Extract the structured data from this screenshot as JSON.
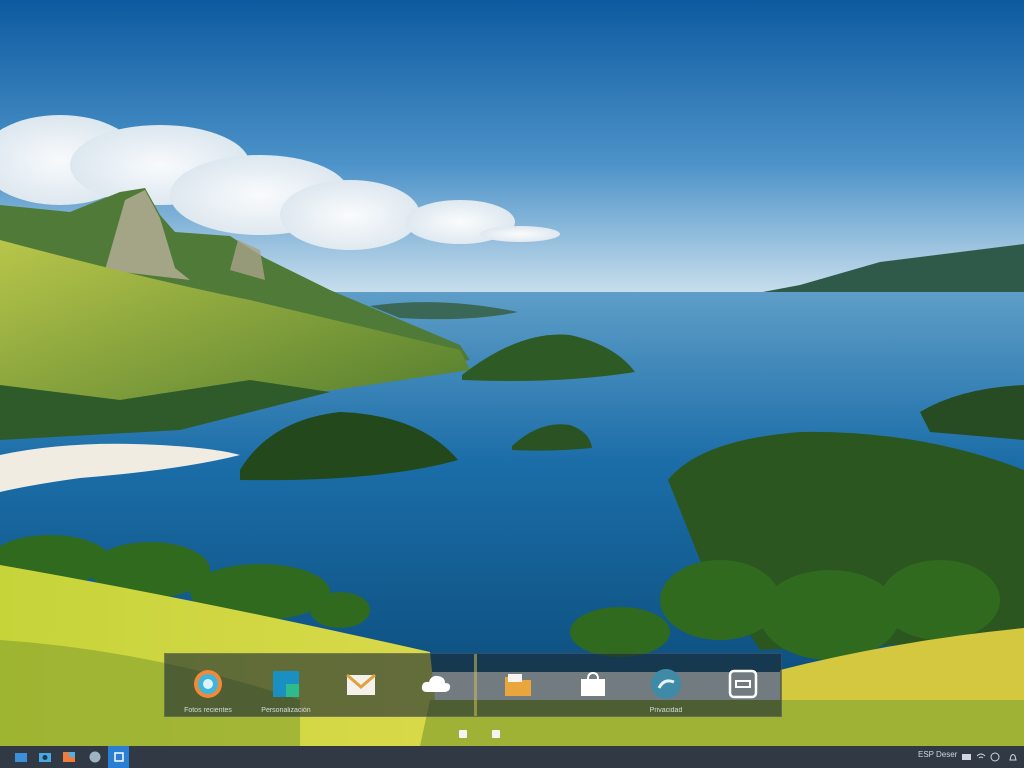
{
  "wallpaper": {
    "name": "coastal-lake-landscape"
  },
  "dock": {
    "items": [
      {
        "icon": "photos-icon",
        "label": "Fotos recientes"
      },
      {
        "icon": "store-app-icon",
        "label": "Personalización"
      },
      {
        "icon": "mail-icon",
        "label": ""
      },
      {
        "icon": "cloud-icon",
        "label": ""
      },
      {
        "icon": "folder-icon",
        "label": ""
      },
      {
        "icon": "store-bag-icon",
        "label": ""
      },
      {
        "icon": "edge-icon",
        "label": "Privacidad"
      },
      {
        "icon": "window-icon",
        "label": ""
      }
    ]
  },
  "taskbar": {
    "apps": [
      "file-explorer-icon",
      "camera-icon",
      "photos-icon",
      "globe-icon",
      "edge-icon"
    ],
    "tray": {
      "left_text": "ESP",
      "right_text": "Deser",
      "icons": [
        "battery-icon",
        "wifi-icon",
        "network-icon"
      ]
    }
  },
  "colors": {
    "sky": "#1e73b8",
    "sea": "#1b6da8",
    "grass": "#c9d83a",
    "taskbar_accent": "#2a7fd4"
  }
}
